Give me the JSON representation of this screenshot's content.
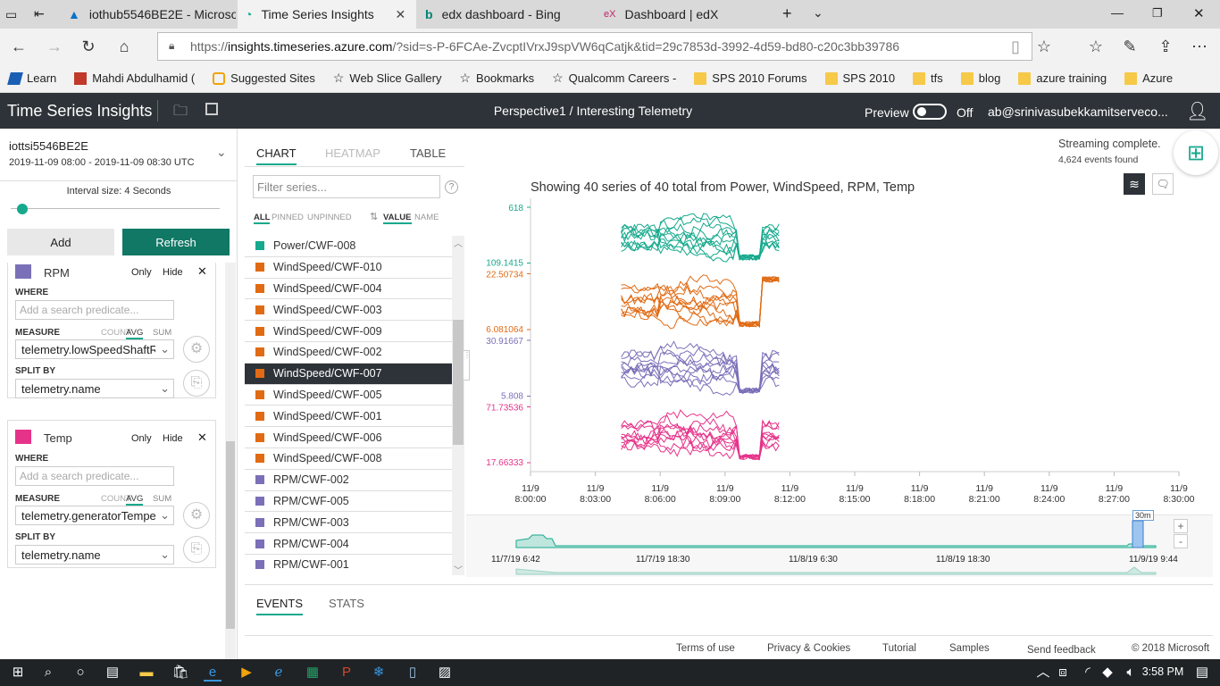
{
  "browser": {
    "tabs": [
      {
        "title": "iothub5546BE2E - Microsofi",
        "icon": "azure-icon"
      },
      {
        "title": "Time Series Insights",
        "icon": "tsi-icon"
      },
      {
        "title": "edx dashboard - Bing",
        "icon": "bing-icon"
      },
      {
        "title": "Dashboard | edX",
        "icon": "edx-icon"
      }
    ],
    "url_prefix": "https://",
    "url_host": "insights.timeseries.azure.com",
    "url_rest": "/?sid=s-P-6FCAe-ZvcptIVrxJ9spVW6qCatjk&tid=29c7853d-3992-4d59-bd80-c20c3bb39786",
    "favorites": [
      "Learn",
      "Mahdi Abdulhamid (",
      "Suggested Sites",
      "Web Slice Gallery",
      "Bookmarks",
      "Qualcomm Careers -",
      "SPS 2010 Forums",
      "SPS 2010",
      "tfs",
      "blog",
      "azure training",
      "Azure"
    ]
  },
  "app": {
    "title": "Time Series Insights",
    "perspective": "Perspective1 / Interesting Telemetry",
    "preview_label": "Preview",
    "preview_state": "Off",
    "user": "ab@srinivasubekkamitserveco..."
  },
  "environment": {
    "name": "iottsi5546BE2E",
    "range": "2019-11-09 08:00  -  2019-11-09 08:30 UTC",
    "interval": "Interval size: 4 Seconds",
    "interval_fraction": 0.03,
    "add_label": "Add",
    "refresh_label": "Refresh",
    "accent": "#117865"
  },
  "queries": [
    {
      "name": "RPM",
      "color": "#7b70b8",
      "only": "Only",
      "hide": "Hide",
      "where_label": "WHERE",
      "placeholder": "Add a search predicate...",
      "measure_label": "MEASURE",
      "count": "COUNT",
      "avg": "AVG",
      "sum": "SUM",
      "measure": "telemetry.lowSpeedShaftRpm",
      "split_label": "SPLIT BY",
      "split": "telemetry.name"
    },
    {
      "name": "Temp",
      "color": "#e6338a",
      "only": "Only",
      "hide": "Hide",
      "where_label": "WHERE",
      "placeholder": "Add a search predicate...",
      "measure_label": "MEASURE",
      "count": "COUNT",
      "avg": "AVG",
      "sum": "SUM",
      "measure": "telemetry.generatorTemperature",
      "split_label": "SPLIT BY",
      "split": "telemetry.name"
    }
  ],
  "views": {
    "chart": "CHART",
    "heatmap": "HEATMAP",
    "table": "TABLE"
  },
  "status": {
    "streaming": "Streaming complete.",
    "events": "4,624 events found"
  },
  "filter": {
    "placeholder": "Filter series...",
    "all": "ALL",
    "pinned": "PINNED",
    "unpinned": "UNPINNED",
    "value": "VALUE",
    "name": "NAME"
  },
  "series": [
    {
      "name": "Power/CWF-008",
      "color": "#16a98d",
      "selected": false
    },
    {
      "name": "WindSpeed/CWF-010",
      "color": "#e06b14",
      "selected": false
    },
    {
      "name": "WindSpeed/CWF-004",
      "color": "#e06b14",
      "selected": false
    },
    {
      "name": "WindSpeed/CWF-003",
      "color": "#e06b14",
      "selected": false
    },
    {
      "name": "WindSpeed/CWF-009",
      "color": "#e06b14",
      "selected": false
    },
    {
      "name": "WindSpeed/CWF-002",
      "color": "#e06b14",
      "selected": false
    },
    {
      "name": "WindSpeed/CWF-007",
      "color": "#e06b14",
      "selected": true
    },
    {
      "name": "WindSpeed/CWF-005",
      "color": "#e06b14",
      "selected": false
    },
    {
      "name": "WindSpeed/CWF-001",
      "color": "#e06b14",
      "selected": false
    },
    {
      "name": "WindSpeed/CWF-006",
      "color": "#e06b14",
      "selected": false
    },
    {
      "name": "WindSpeed/CWF-008",
      "color": "#e06b14",
      "selected": false
    },
    {
      "name": "RPM/CWF-002",
      "color": "#7b70b8",
      "selected": false
    },
    {
      "name": "RPM/CWF-005",
      "color": "#7b70b8",
      "selected": false
    },
    {
      "name": "RPM/CWF-003",
      "color": "#7b70b8",
      "selected": false
    },
    {
      "name": "RPM/CWF-004",
      "color": "#7b70b8",
      "selected": false
    },
    {
      "name": "RPM/CWF-001",
      "color": "#7b70b8",
      "selected": false
    }
  ],
  "chart_data": {
    "type": "line",
    "title": "Showing 40 series of 40 total from Power, WindSpeed, RPM, Temp",
    "x_ticks": [
      [
        "11/9",
        "8:00:00"
      ],
      [
        "11/9",
        "8:03:00"
      ],
      [
        "11/9",
        "8:06:00"
      ],
      [
        "11/9",
        "8:09:00"
      ],
      [
        "11/9",
        "8:12:00"
      ],
      [
        "11/9",
        "8:15:00"
      ],
      [
        "11/9",
        "8:18:00"
      ],
      [
        "11/9",
        "8:21:00"
      ],
      [
        "11/9",
        "8:24:00"
      ],
      [
        "11/9",
        "8:27:00"
      ],
      [
        "11/9",
        "8:30:00"
      ]
    ],
    "data_end_minute": 11.5,
    "lanes": [
      {
        "measure": "Power",
        "color": "#16a98d",
        "ymax": "618",
        "ymin": "109.1415"
      },
      {
        "measure": "WindSpeed",
        "color": "#e06b14",
        "ymax": "22.50734",
        "ymin": "6.081064"
      },
      {
        "measure": "RPM",
        "color": "#7b70b8",
        "ymax": "30.91667",
        "ymin": "5.808"
      },
      {
        "measure": "Temp",
        "color": "#e6338a",
        "ymax": "71.73536",
        "ymin": "17.66333"
      }
    ]
  },
  "brush": {
    "labels": [
      "11/7/19 6:42",
      "11/7/19 18:30",
      "11/8/19 6:30",
      "11/8/19 18:30",
      "11/9/19 9:44"
    ],
    "window_label": "30m"
  },
  "bottom_tabs": {
    "events": "EVENTS",
    "stats": "STATS"
  },
  "footer": [
    "Terms of use",
    "Privacy & Cookies",
    "Tutorial",
    "Samples",
    "Send feedback",
    "© 2018 Microsoft"
  ],
  "taskbar": {
    "time": "3:58 PM"
  }
}
